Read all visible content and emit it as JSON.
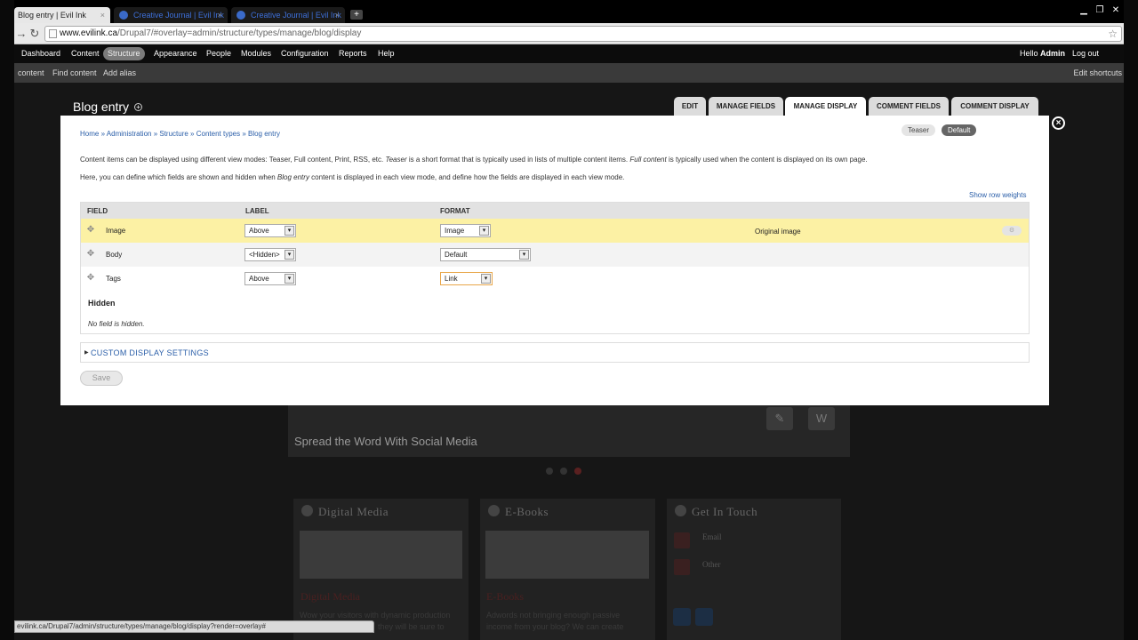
{
  "browser": {
    "tabs": [
      {
        "label": "Blog entry | Evil Ink"
      },
      {
        "label": "Creative Journal | Evil Ink"
      },
      {
        "label": "Creative Journal | Evil Ink"
      }
    ],
    "new_tab": "+",
    "url_host": "www.evilink.ca",
    "url_path": "/Drupal7/#overlay=admin/structure/types/manage/blog/display",
    "status_url": "evilink.ca/Drupal7/admin/structure/types/manage/blog/display?render=overlay#"
  },
  "admin_menu": {
    "items": [
      "Dashboard",
      "Content",
      "Structure",
      "Appearance",
      "People",
      "Modules",
      "Configuration",
      "Reports",
      "Help"
    ],
    "active": "Structure",
    "greeting": "Hello ",
    "username": "Admin",
    "logout": "Log out"
  },
  "shortcuts": {
    "items": [
      "content",
      "Find content",
      "Add alias"
    ],
    "edit": "Edit shortcuts"
  },
  "page": {
    "title": "Blog entry",
    "tabs": [
      "EDIT",
      "MANAGE FIELDS",
      "MANAGE DISPLAY",
      "COMMENT FIELDS",
      "COMMENT DISPLAY"
    ],
    "active_tab": "MANAGE DISPLAY"
  },
  "modal": {
    "breadcrumb": "Home » Administration » Structure » Content types » Blog entry",
    "view_modes": [
      "Teaser",
      "Default"
    ],
    "active_view_mode": "Default",
    "desc1_a": "Content items can be displayed using different view modes: Teaser, Full content, Print, RSS, etc. ",
    "desc1_b": "Teaser",
    "desc1_c": " is a short format that is typically used in lists of multiple content items. ",
    "desc1_d": "Full content",
    "desc1_e": " is typically used when the content is displayed on its own page.",
    "desc2_a": "Here, you can define which fields are shown and hidden when ",
    "desc2_b": "Blog entry",
    "desc2_c": " content is displayed in each view mode, and define how the fields are displayed in each view mode.",
    "show_row_weights": "Show row weights",
    "columns": {
      "field": "FIELD",
      "label": "LABEL",
      "format": "FORMAT"
    },
    "rows": [
      {
        "field": "Image",
        "label": "Above",
        "format": "Image",
        "summary": "Original image"
      },
      {
        "field": "Body",
        "label": "<Hidden>",
        "format": "Default",
        "summary": ""
      },
      {
        "field": "Tags",
        "label": "Above",
        "format": "Link",
        "summary": ""
      }
    ],
    "hidden_heading": "Hidden",
    "no_field_hidden": "No field is hidden.",
    "custom_display_settings": "CUSTOM DISPLAY SETTINGS",
    "save": "Save"
  },
  "background_site": {
    "hero_caption": "Spread the Word With Social Media",
    "boxes": [
      {
        "heading": "Digital Media",
        "subheading": "Digital Media",
        "text": "Wow your visitors with dynamic production",
        "text2": "they will be sure to"
      },
      {
        "heading": "E-Books",
        "subheading": "E-Books",
        "text": "Adwords not bringing enough passive",
        "text2": "income from your blog? We can create"
      },
      {
        "heading": "Get In Touch",
        "contact1": "Email",
        "contact2": "Other"
      }
    ]
  },
  "colors": {
    "highlight_row": "#fcf1a4",
    "link": "#2a5ea8",
    "admin_bar": "#0c0c0c"
  }
}
